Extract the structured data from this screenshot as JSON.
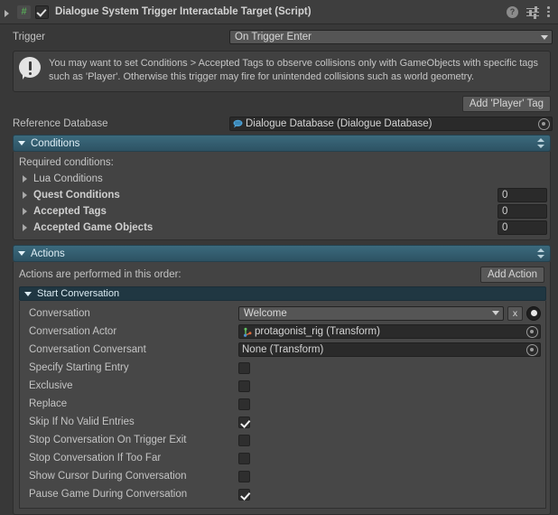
{
  "component": {
    "title": "Dialogue System Trigger Interactable Target (Script)",
    "enabled_checkbox": true,
    "script_icon_glyph": "#",
    "help_icon": "?",
    "icons": {
      "help": "help-icon",
      "preset": "preset-icon",
      "menu": "kebab-menu-icon"
    }
  },
  "trigger": {
    "label": "Trigger",
    "value": "On Trigger Enter"
  },
  "warning": {
    "text": "You may want to set Conditions > Accepted Tags to observe collisions only with GameObjects with specific tags such as 'Player'. Otherwise this trigger may fire for unintended collisions such as world geometry.",
    "button_label": "Add 'Player' Tag"
  },
  "reference_database": {
    "label": "Reference Database",
    "value": "Dialogue Database (Dialogue Database)"
  },
  "conditions": {
    "header": "Conditions",
    "subtitle": "Required conditions:",
    "rows": [
      {
        "label": "Lua Conditions",
        "bold": false,
        "has_count": false,
        "count": ""
      },
      {
        "label": "Quest Conditions",
        "bold": true,
        "has_count": true,
        "count": "0"
      },
      {
        "label": "Accepted Tags",
        "bold": true,
        "has_count": true,
        "count": "0"
      },
      {
        "label": "Accepted Game Objects",
        "bold": true,
        "has_count": true,
        "count": "0"
      }
    ]
  },
  "actions": {
    "header": "Actions",
    "subtitle": "Actions are performed in this order:",
    "add_action_label": "Add Action",
    "start_conversation": {
      "header": "Start Conversation",
      "conversation": {
        "label": "Conversation",
        "value": "Welcome",
        "clear_label": "x"
      },
      "conversation_actor": {
        "label": "Conversation Actor",
        "value": "protagonist_rig (Transform)"
      },
      "conversation_conversant": {
        "label": "Conversation Conversant",
        "value": "None (Transform)"
      },
      "toggles": [
        {
          "label": "Specify Starting Entry",
          "checked": false
        },
        {
          "label": "Exclusive",
          "checked": false
        },
        {
          "label": "Replace",
          "checked": false
        },
        {
          "label": "Skip If No Valid Entries",
          "checked": true
        },
        {
          "label": "Stop Conversation On Trigger Exit",
          "checked": false
        },
        {
          "label": "Stop Conversation If Too Far",
          "checked": false
        },
        {
          "label": "Show Cursor During Conversation",
          "checked": false
        },
        {
          "label": "Pause Game During Conversation",
          "checked": true
        }
      ]
    }
  },
  "colors": {
    "background": "#383838",
    "header_bg": "#3e3e3e",
    "section_accent": "#3b6a7d",
    "action_accent": "#203742",
    "script_icon_green": "#57a657"
  }
}
